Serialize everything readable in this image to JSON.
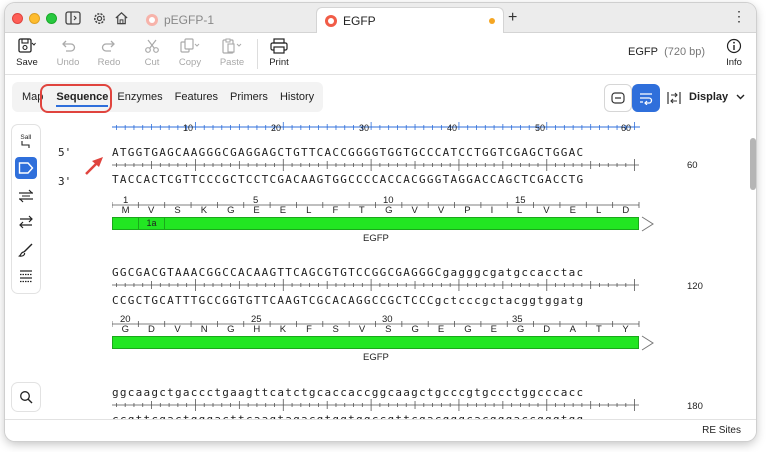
{
  "tabs": [
    {
      "label": "pEGFP-1",
      "active": false
    },
    {
      "label": "EGFP",
      "active": true,
      "unsaved": true
    }
  ],
  "toolbar": {
    "save": "Save",
    "undo": "Undo",
    "redo": "Redo",
    "cut": "Cut",
    "copy": "Copy",
    "paste": "Paste",
    "print": "Print",
    "info": "Info",
    "sequence_name": "EGFP",
    "sequence_length": "(720 bp)"
  },
  "view_tabs": [
    "Map",
    "Sequence",
    "Enzymes",
    "Features",
    "Primers",
    "History"
  ],
  "active_view": "Sequence",
  "display_button": "Display",
  "left_tools": {
    "sall": "SalI"
  },
  "ruler": {
    "ticks": [
      "10",
      "20",
      "30",
      "40",
      "50",
      "60"
    ]
  },
  "strand_labels": {
    "top": "5'",
    "bottom": "3'"
  },
  "rows": [
    {
      "top": "ATGGTGAGCAAGGGCGAGGAGCTGTTCACCGGGGTGGTGCCCATCCTGGTCGAGCTGGAC",
      "bottom": "TACCACTCGTTCCCGCTCCTCGACAAGTGGCCCCACCACGGGTAGGACCAGCTCGACCTG",
      "end": "60",
      "aa_numbers": [
        "1",
        "5",
        "10",
        "15"
      ],
      "aa": [
        "M",
        "V",
        "S",
        "K",
        "G",
        "E",
        "E",
        "L",
        "F",
        "T",
        "G",
        "V",
        "V",
        "P",
        "I",
        "L",
        "V",
        "E",
        "L",
        "D"
      ],
      "segment_label": "1a",
      "feature": "EGFP"
    },
    {
      "top": "GGCGACGTAAACGGCCACAAGTTCAGCGTGTCCGGCGAGGGCgagggcgatgccacctac",
      "bottom": "CCGCTGCATTTGCCGGTGTTCAAGTCGCACAGGCCGCTCCCgctcccgctacggtggatg",
      "end": "120",
      "aa_numbers": [
        "20",
        "25",
        "30",
        "35"
      ],
      "aa": [
        "G",
        "D",
        "V",
        "N",
        "G",
        "H",
        "K",
        "F",
        "S",
        "V",
        "S",
        "G",
        "E",
        "G",
        "E",
        "G",
        "D",
        "A",
        "T",
        "Y"
      ],
      "feature": "EGFP"
    },
    {
      "top": "ggcaagctgaccctgaagttcatctgcaccaccggcaagctgcccgtgccctggcccacc",
      "bottom": "ccgttcgactgggacttcaagtagacgtggtggccgttcgacgggcacgggaccgggtgg",
      "end": "180"
    }
  ],
  "status": {
    "re_sites": "RE Sites"
  },
  "colors": {
    "accent": "#2f6fdb",
    "feature_fill": "#22e622",
    "highlight": "#e0443e"
  }
}
